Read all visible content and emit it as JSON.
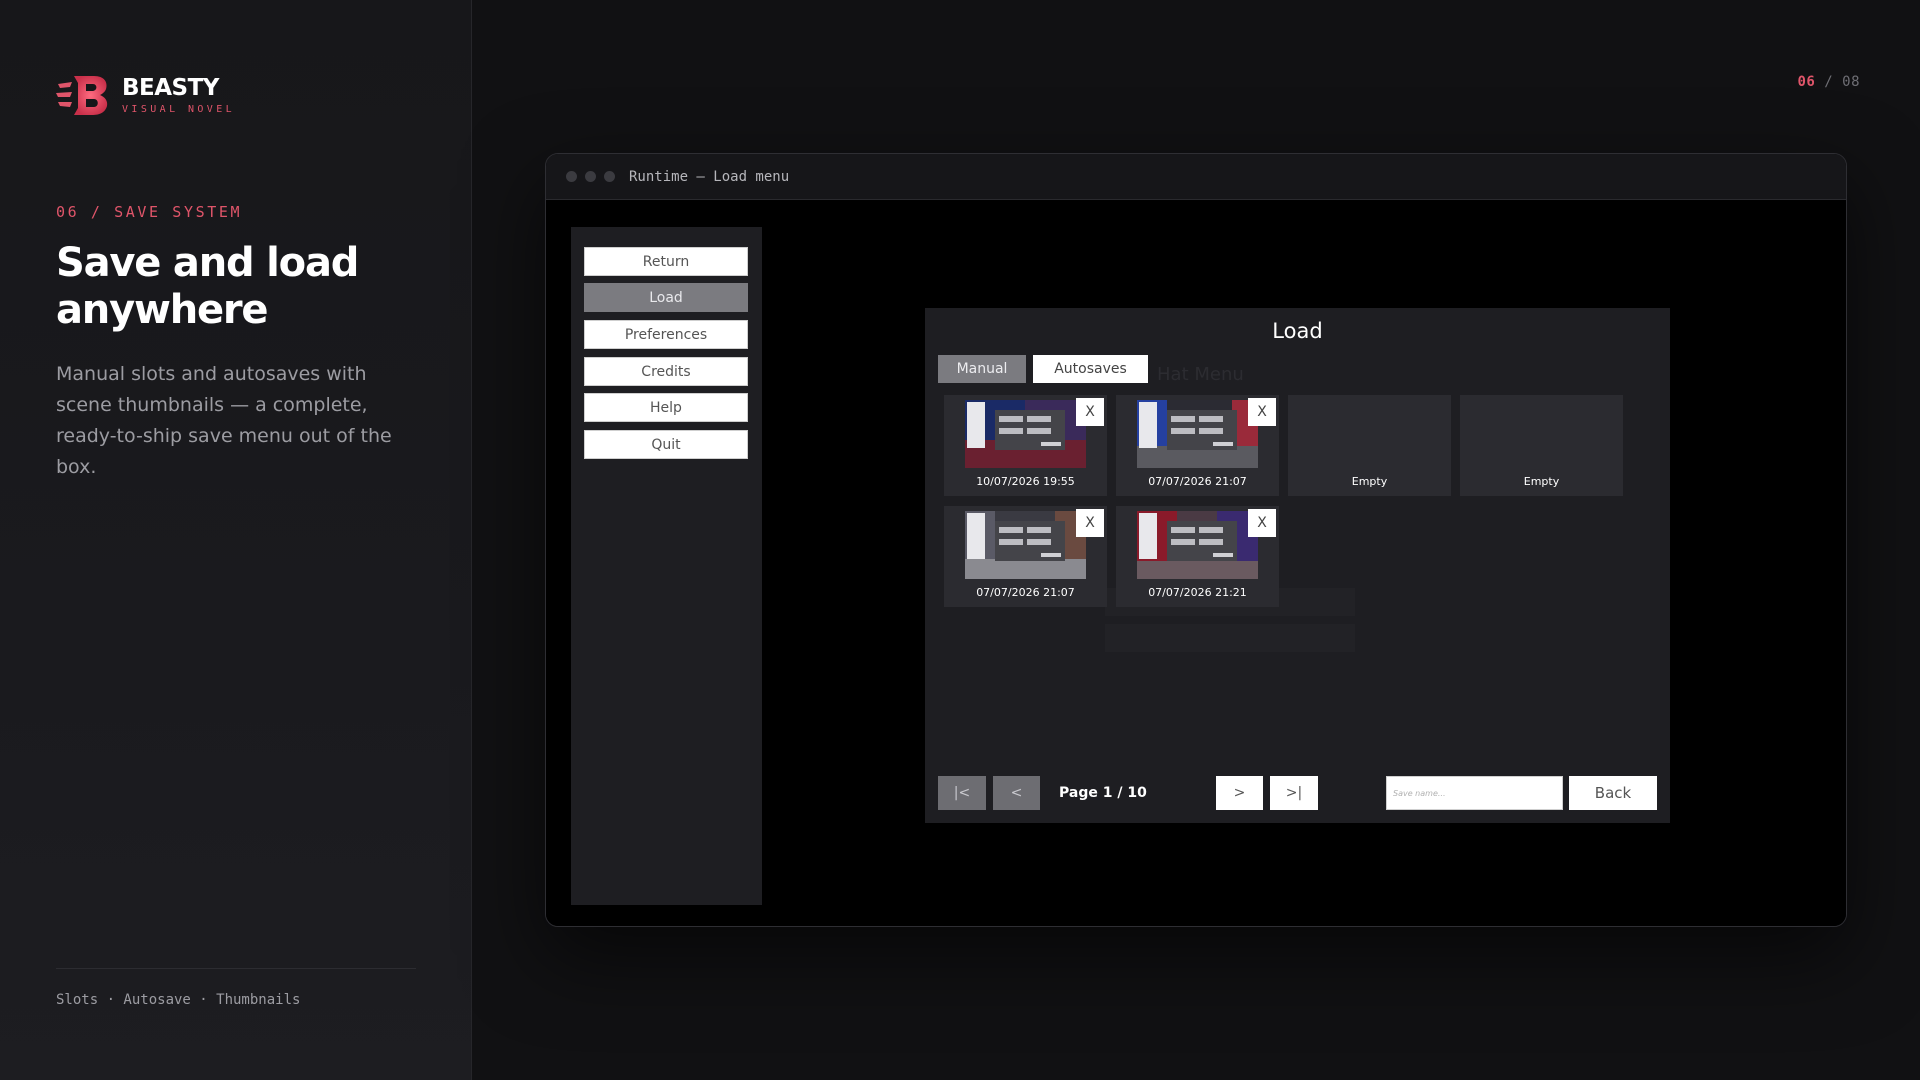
{
  "brand": {
    "name": "BEASTY",
    "subtitle": "VISUAL NOVEL",
    "accent": "#e0556a"
  },
  "section": {
    "label": "06 / SAVE SYSTEM",
    "title": "Save and load anywhere",
    "description": "Manual slots and autosaves with scene thumbnails — a complete, ready-to-ship save menu out of the box."
  },
  "footer": {
    "tags": "Slots · Autosave · Thumbnails"
  },
  "pagination": {
    "current": "06",
    "separator": " / ",
    "total": "08"
  },
  "window": {
    "title": "Runtime — Load menu"
  },
  "game_menu": {
    "items": [
      "Return",
      "Load",
      "Preferences",
      "Credits",
      "Help",
      "Quit"
    ],
    "active": "Load"
  },
  "load_screen": {
    "title": "Load",
    "ghost_text": "Hat Menu",
    "tabs": {
      "manual": "Manual",
      "autosaves": "Autosaves"
    },
    "slots": [
      {
        "label": "10/07/2026 19:55",
        "delete": "X"
      },
      {
        "label": "07/07/2026 21:07",
        "delete": "X"
      },
      {
        "label": "Empty"
      },
      {
        "label": "Empty"
      },
      {
        "label": "07/07/2026 21:07",
        "delete": "X"
      },
      {
        "label": "07/07/2026 21:21",
        "delete": "X"
      }
    ],
    "nav": {
      "first": "|<",
      "prev": "<",
      "page": "Page 1 / 10",
      "next": ">",
      "last": ">|"
    },
    "save_name_placeholder": "Save name...",
    "back": "Back"
  }
}
